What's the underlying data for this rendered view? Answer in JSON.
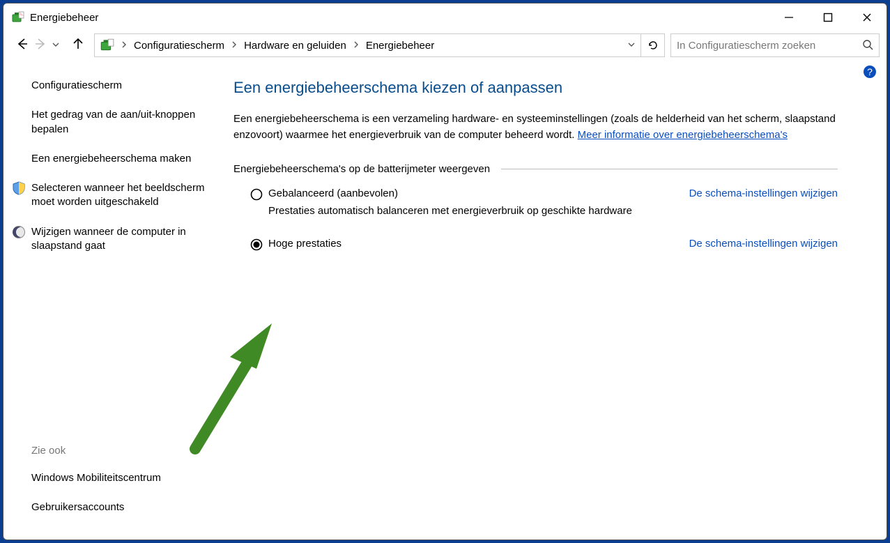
{
  "window": {
    "title": "Energiebeheer"
  },
  "breadcrumbs": {
    "seg1": "Configuratiescherm",
    "seg2": "Hardware en geluiden",
    "seg3": "Energiebeheer"
  },
  "search": {
    "placeholder": "In Configuratiescherm zoeken"
  },
  "sidebar": {
    "link_cp": "Configuratiescherm",
    "link_buttons": "Het gedrag van de aan/uit-knoppen bepalen",
    "link_create": "Een energiebeheerschema maken",
    "link_display": "Selecteren wanneer het beeldscherm moet worden uitgeschakeld",
    "link_sleep": "Wijzigen wanneer de computer in slaapstand gaat"
  },
  "seealso": {
    "header": "Zie ook",
    "link_mobility": "Windows Mobiliteitscentrum",
    "link_accounts": "Gebruikersaccounts"
  },
  "main": {
    "heading": "Een energiebeheerschema kiezen of aanpassen",
    "desc_pre": "Een energiebeheerschema is een verzameling hardware- en systeeminstellingen (zoals de helderheid van het scherm, slaapstand enzovoort) waarmee het energieverbruik van de computer beheerd wordt. ",
    "desc_link": "Meer informatie over energiebeheerschema's",
    "group_label": "Energiebeheerschema's op de batterijmeter weergeven",
    "plan1_name": "Gebalanceerd (aanbevolen)",
    "plan1_desc": "Prestaties automatisch balanceren met energieverbruik op geschikte hardware",
    "plan2_name": "Hoge prestaties",
    "change_link": "De schema-instellingen wijzigen"
  }
}
